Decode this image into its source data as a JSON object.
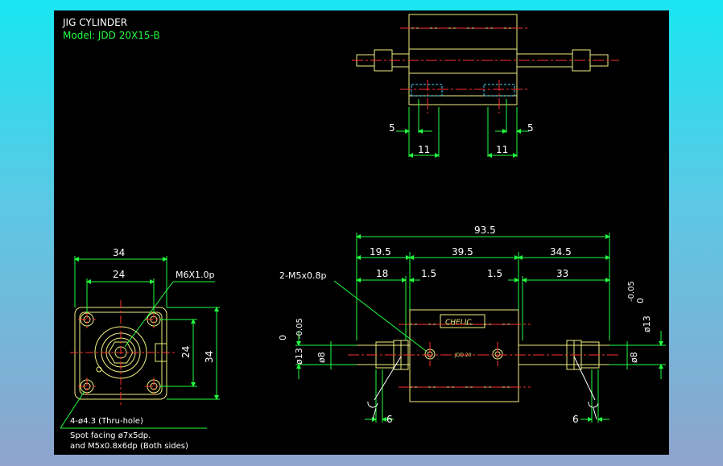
{
  "title_block": {
    "title": "JIG CYLINDER",
    "model": "Model:  JDD 20X15-B"
  },
  "top_view": {
    "dim_left_offset": "5",
    "dim_right_offset": "5",
    "dim_left_width": "11",
    "dim_right_width": "11"
  },
  "side_view": {
    "dim_overall": "93.5",
    "dim_left_section": "19.5",
    "dim_body": "39.5",
    "dim_right_section": "34.5",
    "dim_left_rod": "18",
    "dim_left_gap": "1.5",
    "dim_right_gap": "1.5",
    "dim_right_rod": "33",
    "port_callout": "2-M5x0.8p",
    "rod_dia_left_upper": "0",
    "rod_dia_left_lower": "-0.05",
    "rod_dia_left_base": "ø13",
    "rod_dia_right_upper": "0",
    "rod_dia_right_lower": "-0.05",
    "rod_dia_right_base": "ø13",
    "thread_dia_left": "ø8",
    "thread_dia_right": "ø8",
    "nut_width_left": "6",
    "nut_width_right": "6",
    "nameplate": "CHELIC",
    "model_mark": "JDD 20"
  },
  "end_view": {
    "dim_width_outer": "34",
    "dim_width_inner": "24",
    "dim_height_inner": "24",
    "dim_height_outer": "34",
    "thread_callout": "M6X1.0p",
    "hole_callout": "4-ø4.3 (Thru-hole)",
    "note_line1": "Spot facing  ø7x5dp.",
    "note_line2": "and M5x0.8x6dp (Both sides)"
  },
  "colors": {
    "background": "#000000",
    "outline": "#f0f080",
    "dimension": "#20ff40",
    "centerline": "#ff3030",
    "text": "#ffffff",
    "hidden": "#40d0ff"
  }
}
